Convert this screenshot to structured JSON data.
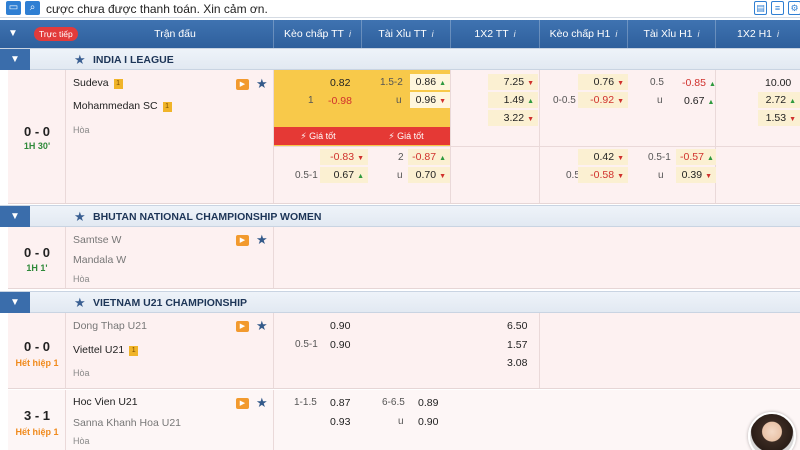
{
  "topbar": {
    "notice": "cược chưa được thanh toán. Xin cảm ơn."
  },
  "header": {
    "live_label": "Trực tiếp",
    "match_col": "Trận đấu",
    "hdp_ft": "Kèo chấp TT",
    "ou_ft": "Tài Xỉu TT",
    "x12_ft": "1X2 TT",
    "hdp_h1": "Kèo chấp H1",
    "ou_h1": "Tài Xỉu H1",
    "x12_h1": "1X2 H1",
    "info": "i"
  },
  "leagues": [
    {
      "name": "INDIA I LEAGUE"
    },
    {
      "name": "BHUTAN NATIONAL CHAMPIONSHIP WOMEN"
    },
    {
      "name": "VIETNAM U21 CHAMPIONSHIP"
    }
  ],
  "matches": [
    {
      "score": "0 - 0",
      "time": "1H 30'",
      "home": "Sudeva",
      "home_badge": "1",
      "away": "Mohammedan SC",
      "away_badge": "1",
      "draw": "Hòa",
      "best_price": "Giá tốt",
      "row1": {
        "hdp_home": "0.82",
        "hdp_line": "1",
        "hdp_away": "-0.98",
        "ou_line": "1.5-2",
        "ou_over": "0.86",
        "ou_u": "u",
        "ou_under": "0.96",
        "x12": [
          "7.25",
          "1.49",
          "3.22"
        ],
        "h1_hdp_home": "0.76",
        "h1_hdp_line": "0-0.5",
        "h1_hdp_away": "-0.92",
        "h1_ou_line": "0.5",
        "h1_ou_over": "-0.85",
        "h1_ou_u": "u",
        "h1_ou_under": "0.67",
        "h1_x12": [
          "10.00",
          "2.72",
          "1.53"
        ]
      },
      "row2": {
        "hdp_home": "-0.83",
        "hdp_line": "0.5-1",
        "hdp_away": "0.67",
        "ou_line": "2",
        "ou_over": "-0.87",
        "ou_u": "u",
        "ou_under": "0.70",
        "h1_hdp_home": "0.42",
        "h1_hdp_line": "0.5",
        "h1_hdp_away": "-0.58",
        "h1_ou_line": "0.5-1",
        "h1_ou_over": "-0.57",
        "h1_ou_u": "u",
        "h1_ou_under": "0.39"
      }
    },
    {
      "score": "0 - 0",
      "time": "1H 1'",
      "home": "Samtse W",
      "away": "Mandala W",
      "draw": "Hòa"
    },
    {
      "score": "0 - 0",
      "time": "Hết hiệp 1",
      "home": "Dong Thap U21",
      "away": "Viettel U21",
      "away_badge": "1",
      "draw": "Hòa",
      "hdp_home": "0.90",
      "hdp_line": "0.5-1",
      "hdp_away": "0.90",
      "x12": [
        "6.50",
        "1.57",
        "3.08"
      ]
    },
    {
      "score": "3 - 1",
      "time": "Hết hiệp 1",
      "home": "Hoc Vien U21",
      "away": "Sanna Khanh Hoa U21",
      "draw": "Hòa",
      "hdp_line": "1-1.5",
      "hdp_home": "0.87",
      "hdp_away": "0.93",
      "ou_line": "6-6.5",
      "ou_over": "0.89",
      "ou_u": "u",
      "ou_under": "0.90"
    }
  ],
  "icons": {
    "tv": "tv-icon",
    "star": "star-icon",
    "bolt": "⚡"
  }
}
